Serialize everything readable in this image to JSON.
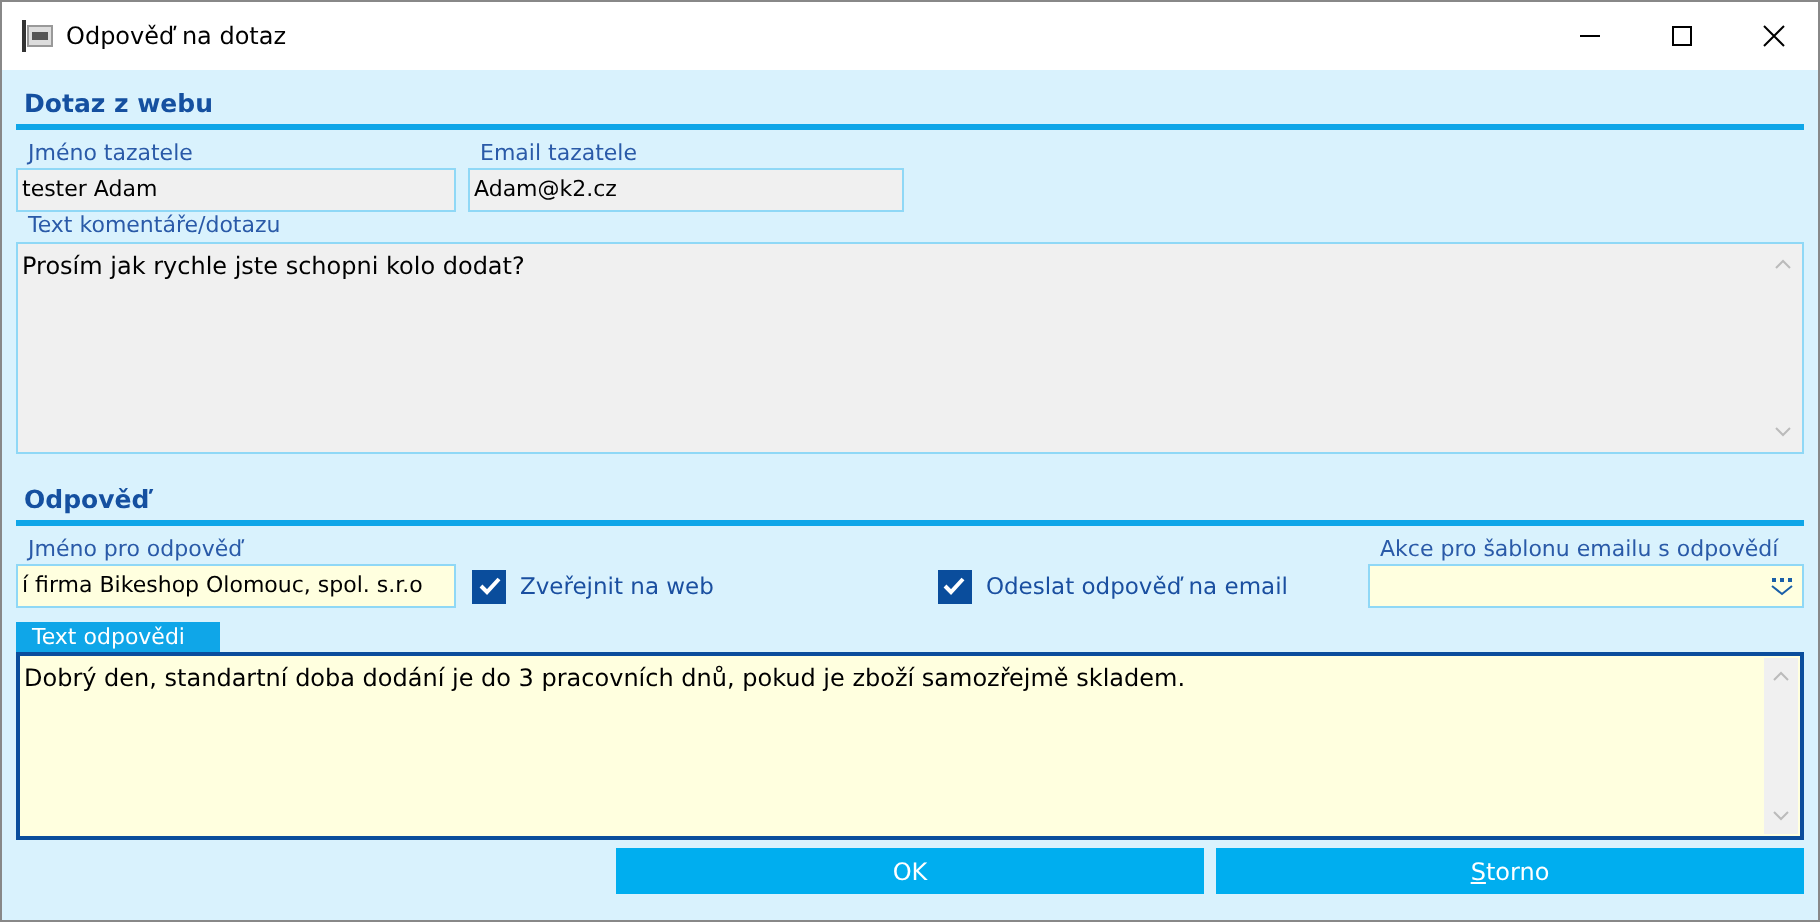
{
  "window": {
    "title": "Odpověď na dotaz"
  },
  "query": {
    "heading": "Dotaz z webu",
    "name": {
      "label": "Jméno tazatele",
      "value": "tester Adam"
    },
    "email": {
      "label": "Email tazatele",
      "value": "Adam@k2.cz"
    },
    "comment": {
      "label": "Text komentáře/dotazu",
      "value": "Prosím jak rychle jste schopni kolo dodat?"
    }
  },
  "answer": {
    "heading": "Odpověď",
    "name": {
      "label": "Jméno pro odpověď",
      "value": "í firma Bikeshop Olomouc, spol. s.r.o"
    },
    "checkboxes": [
      {
        "label": "Zveřejnit na web",
        "checked": true
      },
      {
        "label": "Odeslat odpověď na email",
        "checked": true
      }
    ],
    "template": {
      "label": "Akce pro šablonu emailu s odpovědí"
    },
    "text": {
      "label": "Text odpovědi",
      "value": "Dobrý den, standartní doba dodání je do 3 pracovních dnů, pokud je zboží samozřejmě skladem."
    }
  },
  "buttons": [
    {
      "label": "OK"
    },
    {
      "mnemonic": "S",
      "label": "torno"
    }
  ]
}
